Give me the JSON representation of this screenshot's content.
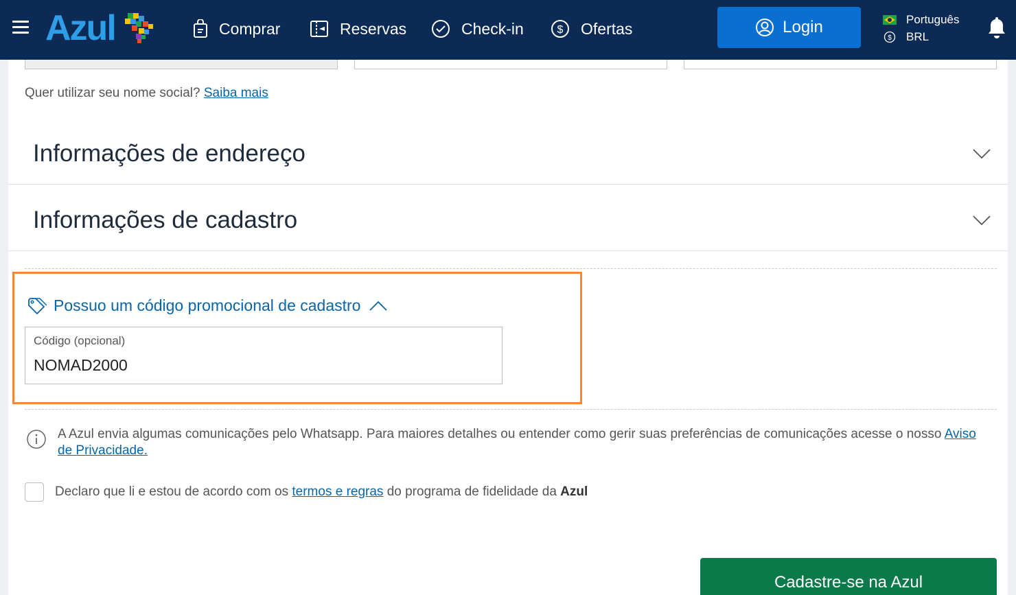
{
  "header": {
    "logo": "Azul",
    "nav": [
      {
        "label": "Comprar",
        "icon": "bag-icon"
      },
      {
        "label": "Reservas",
        "icon": "ticket-icon"
      },
      {
        "label": "Check-in",
        "icon": "check-circle-icon"
      },
      {
        "label": "Ofertas",
        "icon": "dollar-circle-icon"
      }
    ],
    "login_label": "Login",
    "language": "Português",
    "currency": "BRL"
  },
  "form": {
    "social_name_prompt": "Quer utilizar seu nome social?",
    "social_name_link": "Saiba mais",
    "sections": [
      {
        "title": "Informações de endereço",
        "expanded": false
      },
      {
        "title": "Informações de cadastro",
        "expanded": false
      }
    ],
    "promo": {
      "toggle_label": "Possuo um código promocional de cadastro",
      "field_label": "Código (opcional)",
      "field_value": "NOMAD2000"
    },
    "whatsapp_notice": {
      "text": "A Azul envia algumas comunicações pelo Whatsapp. Para maiores detalhes ou entender como gerir suas preferências de comunicações acesse o nosso",
      "link": "Aviso de Privacidade."
    },
    "terms": {
      "checked": false,
      "prefix": "Declaro que li e estou de acordo com os",
      "link": "termos e regras",
      "middle": "do programa de fidelidade da",
      "brand": "Azul"
    },
    "submit_label": "Cadastre-se na Azul"
  },
  "colors": {
    "header_bg": "#0b2a55",
    "accent_blue": "#0a6fd0",
    "link_blue": "#0a64a8",
    "highlight_orange": "#f0893a",
    "submit_green": "#0b7a4a"
  }
}
